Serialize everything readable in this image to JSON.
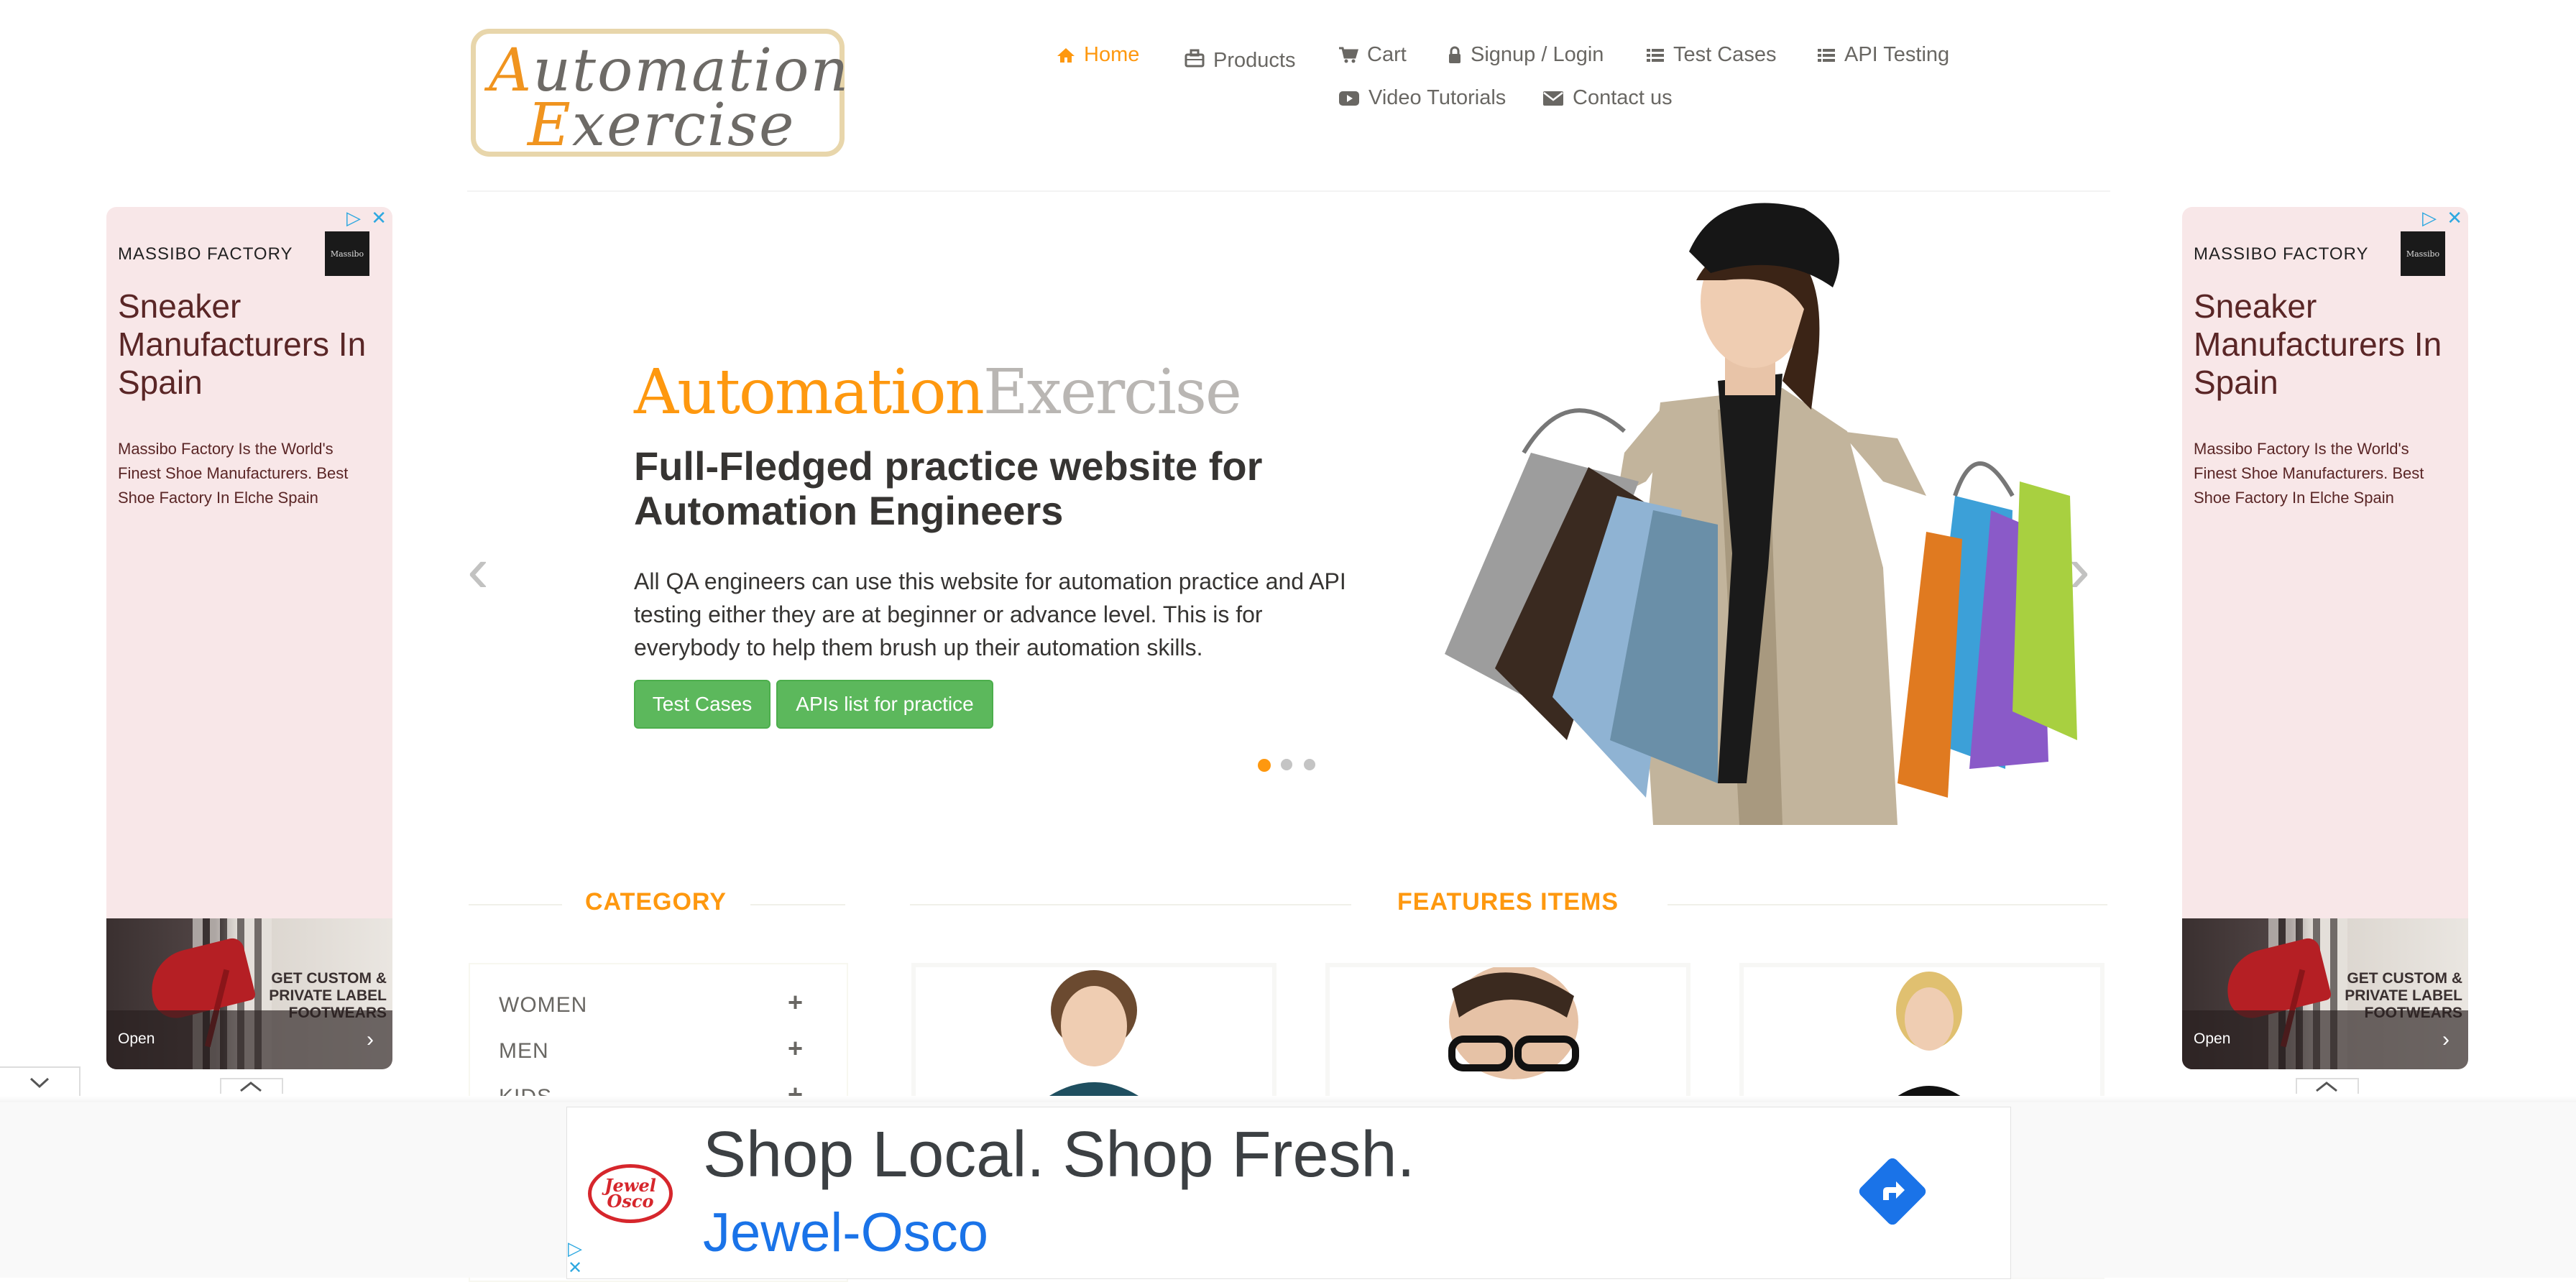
{
  "header": {
    "logo": {
      "line1_cap": "A",
      "line1_rest": "utomation",
      "line2_cap": "E",
      "line2_rest": "xercise"
    },
    "nav": [
      {
        "label": "Home",
        "icon": "home-icon",
        "active": true
      },
      {
        "label": "Products",
        "icon": "briefcase-icon"
      },
      {
        "label": "Cart",
        "icon": "cart-icon"
      },
      {
        "label": "Signup / Login",
        "icon": "lock-icon"
      },
      {
        "label": "Test Cases",
        "icon": "list-icon"
      },
      {
        "label": "API Testing",
        "icon": "list-icon"
      },
      {
        "label": "Video Tutorials",
        "icon": "youtube-icon"
      },
      {
        "label": "Contact us",
        "icon": "envelope-icon"
      }
    ]
  },
  "side_ad": {
    "brand": "MASSIBO FACTORY",
    "brand_logo": "Massibo",
    "title": "Sneaker Manufacturers In Spain",
    "description": "Massibo Factory Is the World's Finest Shoe Manufacturers. Best Shoe Factory In Elche Spain",
    "promo": "GET CUSTOM & PRIVATE LABEL FOOTWEARS",
    "open_label": "Open"
  },
  "hero": {
    "brand_orange": "Automation",
    "brand_gray": "Exercise",
    "heading": "Full-Fledged practice website for Automation Engineers",
    "paragraph": "All QA engineers can use this website for automation practice and API testing either they are at beginner or advance level. This is for everybody to help them brush up their automation skills.",
    "button_test_cases": "Test Cases",
    "button_apis": "APIs list for practice",
    "carousel_active": 1,
    "carousel_count": 3
  },
  "category": {
    "title": "CATEGORY",
    "items": [
      "WOMEN",
      "MEN",
      "KIDS"
    ]
  },
  "features": {
    "title": "FEATURES ITEMS"
  },
  "bottom_ad": {
    "headline": "Shop Local. Shop Fresh.",
    "advertiser": "Jewel-Osco",
    "logo_text_1": "Jewel",
    "logo_text_2": "Osco"
  },
  "colors": {
    "accent": "#fe980f",
    "button_green": "#5cb85c",
    "ad_bg": "#f8e7e8",
    "link_blue": "#1a73e8"
  }
}
